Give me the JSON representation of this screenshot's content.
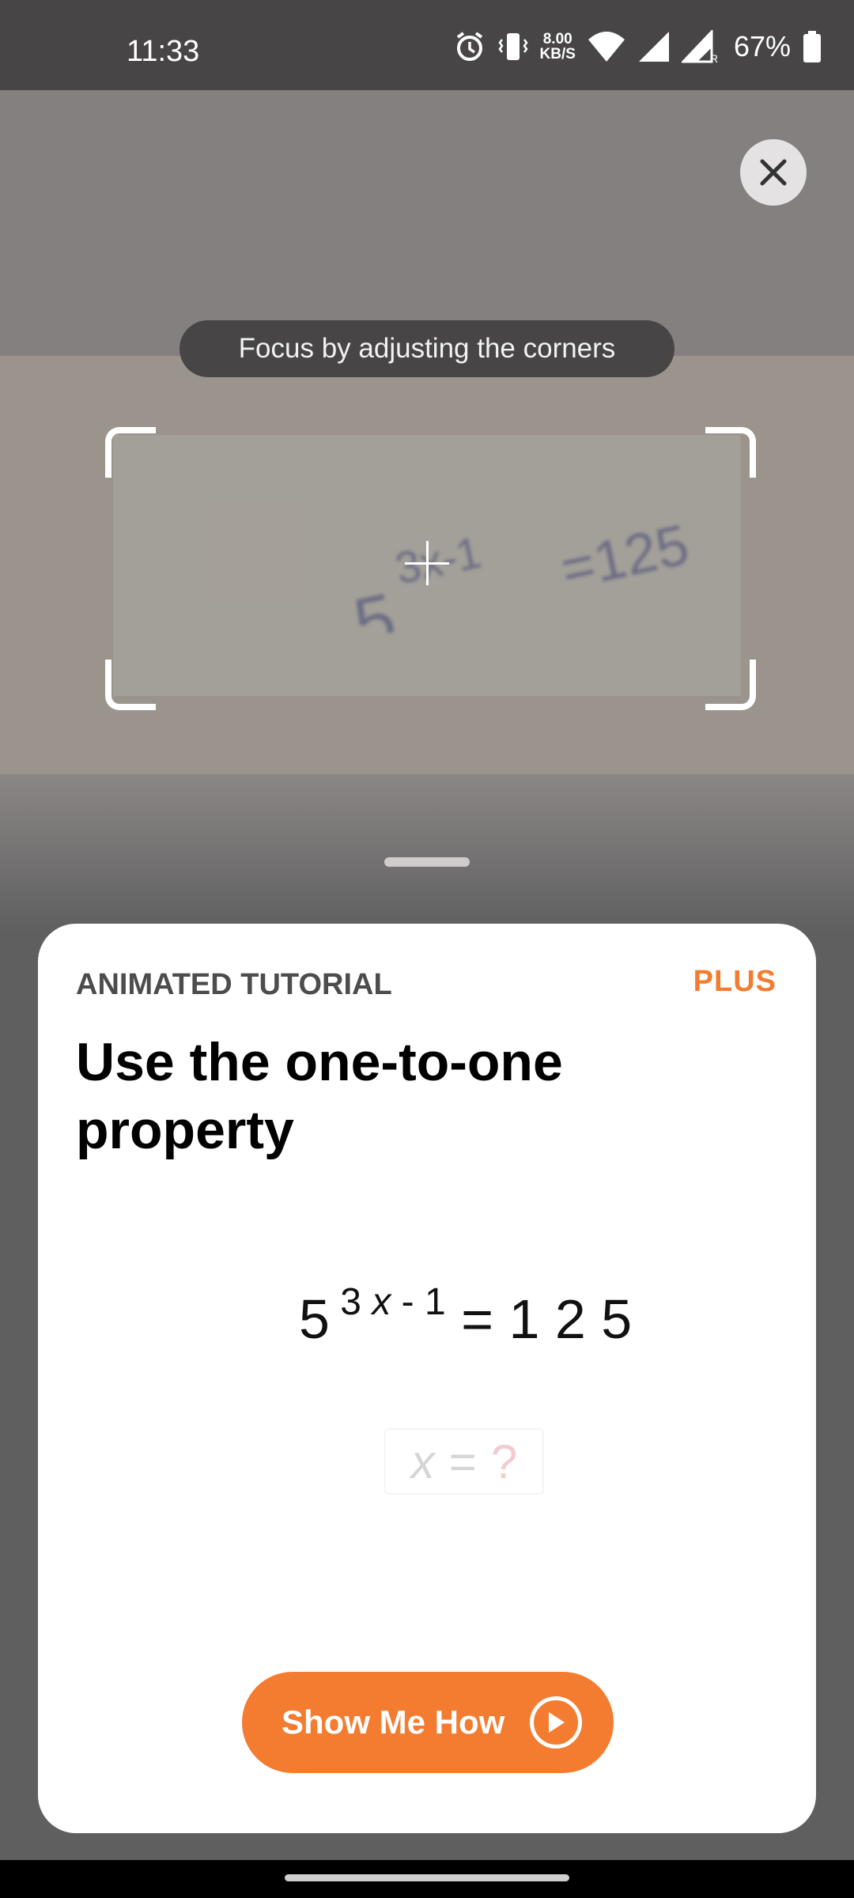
{
  "status_bar": {
    "time": "11:33",
    "net_speed_value": "8.00",
    "net_speed_unit": "KB/S",
    "battery": "67%"
  },
  "camera": {
    "hint": "Focus by adjusting the corners",
    "captured_text": "5^(3x-1) = 125"
  },
  "card": {
    "eyebrow": "ANIMATED TUTORIAL",
    "badge": "PLUS",
    "title": "Use the one-to-one property",
    "equation": {
      "base": "5",
      "exponent_coef": "3",
      "exponent_var": "x",
      "exponent_rest": "- 1",
      "equals": "=",
      "rhs": "1 2 5"
    },
    "answer": {
      "variable": "x",
      "equals": "=",
      "unknown": "?"
    },
    "cta_label": "Show Me How"
  },
  "colors": {
    "accent": "#f47c30",
    "status_bar": "#474545",
    "backdrop": "#5f5f5f"
  },
  "icons": [
    "alarm-icon",
    "vibrate-icon",
    "wifi-icon",
    "signal-icon",
    "battery-icon",
    "close-icon",
    "crosshair-icon",
    "play-icon"
  ]
}
